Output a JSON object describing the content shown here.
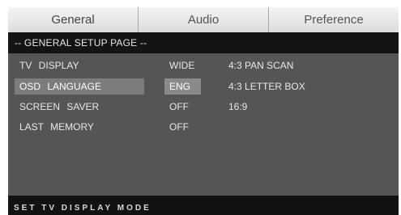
{
  "tabs": [
    {
      "label": "General"
    },
    {
      "label": "Audio"
    },
    {
      "label": "Preference"
    }
  ],
  "page_title": "-- GENERAL SETUP PAGE  --",
  "settings": [
    {
      "label": "TV  DISPLAY",
      "value": "WIDE",
      "option": "4:3 PAN SCAN"
    },
    {
      "label": "OSD   LANGUAGE",
      "value": "ENG",
      "option": "4:3 LETTER BOX"
    },
    {
      "label": "SCREEN   SAVER",
      "value": "OFF",
      "option": "16:9"
    },
    {
      "label": "LAST    MEMORY",
      "value": "OFF",
      "option": ""
    }
  ],
  "status_text": "SET TV DISPLAY MODE"
}
